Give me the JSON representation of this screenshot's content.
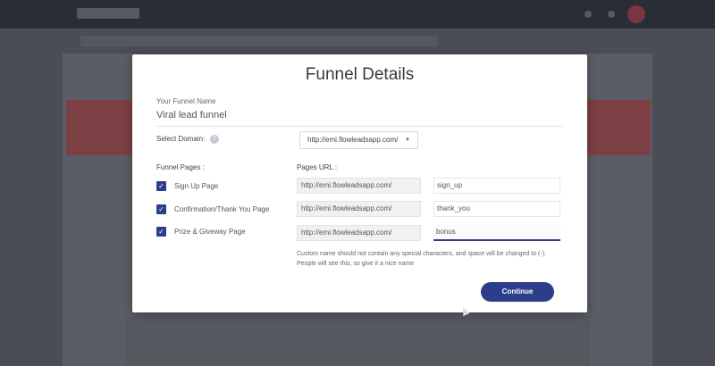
{
  "modal": {
    "title": "Funnel Details",
    "funnel_name_label": "Your Funnel Name",
    "funnel_name_value": "Viral lead funnel",
    "select_domain_label": "Select Domain:",
    "domain_selected": "http://emi.flowleadsapp.com/",
    "funnel_pages_label": "Funnel Pages :",
    "pages_url_label": "Pages URL :",
    "pages": [
      {
        "label": "Sign Up Page",
        "checked": true,
        "base_url": "http://emi.flowleadsapp.com/",
        "slug": "sign_up"
      },
      {
        "label": "Confirmation/Thank You Page",
        "checked": true,
        "base_url": "http://emi.flowleadsapp.com/",
        "slug": "thank_you"
      },
      {
        "label": "Prize & Giveway Page",
        "checked": true,
        "base_url": "http://emi.flowleadsapp.com/",
        "slug": "bonus"
      }
    ],
    "hint_line1": "Custom name should not contain any special characters, and space will be changed to (-).",
    "hint_line2": "People will see this, so give it a nice name",
    "continue_label": "Continue"
  },
  "icons": {
    "help": "help-icon",
    "check": "check-icon",
    "dropdown": "chevron-down-icon"
  },
  "colors": {
    "accent": "#2c3e8a",
    "overlay": "#4a4d55"
  }
}
